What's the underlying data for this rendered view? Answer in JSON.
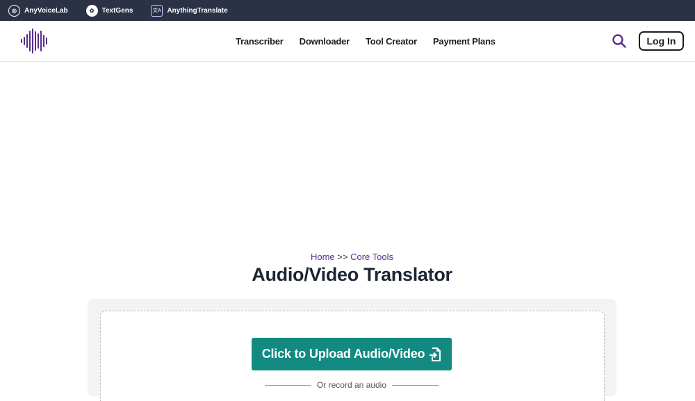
{
  "brands": [
    {
      "label": "AnyVoiceLab",
      "icon": "anyvoicelab-icon"
    },
    {
      "label": "TextGens",
      "icon": "textgens-icon"
    },
    {
      "label": "AnythingTranslate",
      "icon": "translate-icon"
    }
  ],
  "nav": {
    "items": [
      "Transcriber",
      "Downloader",
      "Tool Creator",
      "Payment Plans"
    ],
    "login_label": "Log In"
  },
  "breadcrumb": {
    "home": "Home",
    "separator": ">>",
    "section": "Core Tools"
  },
  "page_title": "Audio/Video Translator",
  "upload": {
    "button_label": "Click to Upload Audio/Video",
    "or_record": "Or record an audio"
  },
  "colors": {
    "topbar": "#2b3245",
    "accent": "#5b2d8f",
    "upload_button": "#128a82"
  }
}
